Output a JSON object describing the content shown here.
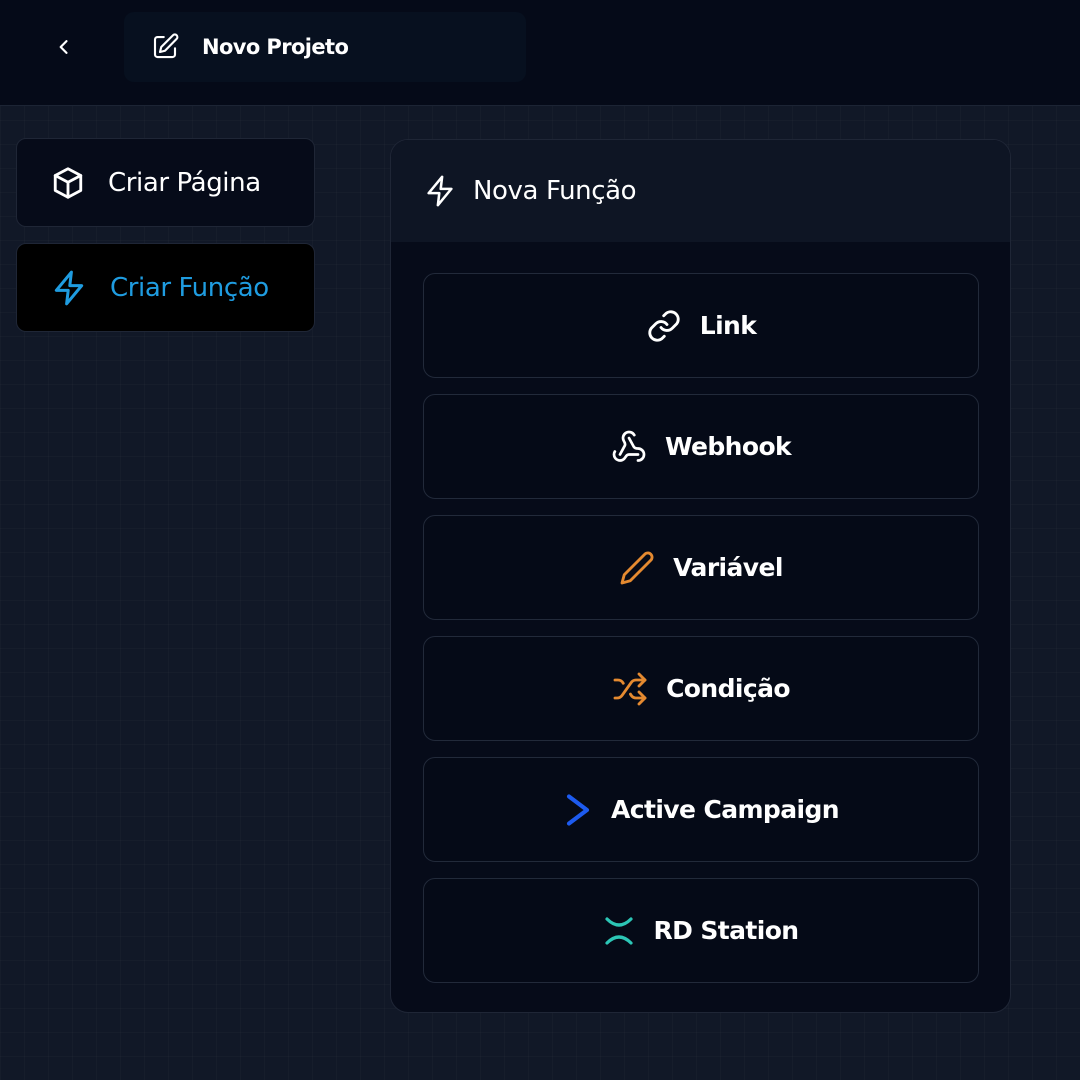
{
  "header": {
    "back_icon": "chevron-left-icon",
    "edit_icon": "pencil-square-icon",
    "project_title": "Novo Projeto"
  },
  "sidebar": {
    "items": [
      {
        "label": "Criar Página",
        "icon": "cube-icon",
        "active": false
      },
      {
        "label": "Criar Função",
        "icon": "lightning-icon",
        "active": true
      }
    ]
  },
  "panel": {
    "title": "Nova Função",
    "icon": "lightning-icon",
    "options": [
      {
        "label": "Link",
        "icon": "link-icon",
        "icon_color": "#ffffff"
      },
      {
        "label": "Webhook",
        "icon": "webhook-icon",
        "icon_color": "#ffffff"
      },
      {
        "label": "Variável",
        "icon": "pencil-icon",
        "icon_color": "#e58a30"
      },
      {
        "label": "Condição",
        "icon": "shuffle-icon",
        "icon_color": "#e58a30"
      },
      {
        "label": "Active Campaign",
        "icon": "active-campaign-icon",
        "icon_color": "#1d5bf0"
      },
      {
        "label": "RD Station",
        "icon": "rd-station-icon",
        "icon_color": "#2cc6b6"
      }
    ]
  },
  "colors": {
    "accent": "#1f9ce0",
    "background": "#111827",
    "surface": "#060b19"
  }
}
